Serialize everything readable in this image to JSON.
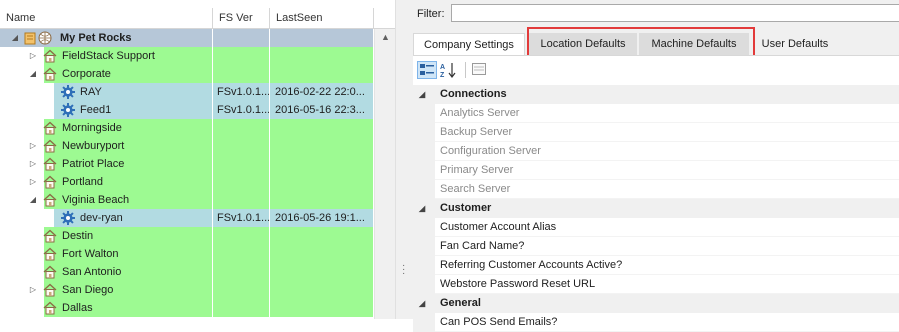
{
  "tree": {
    "columns": [
      "Name",
      "FS Ver",
      "LastSeen"
    ],
    "rows": [
      {
        "name": "My Pet Rocks",
        "fs": "",
        "last": "",
        "level": 0,
        "bg": "root",
        "expander": "expanded",
        "icon": "root-org-icon",
        "bold": true
      },
      {
        "name": "FieldStack Support",
        "fs": "",
        "last": "",
        "level": 1,
        "bg": "green",
        "expander": "collapsed",
        "icon": "house-icon"
      },
      {
        "name": "Corporate",
        "fs": "",
        "last": "",
        "level": 1,
        "bg": "green",
        "expander": "expanded",
        "icon": "house-icon"
      },
      {
        "name": "RAY",
        "fs": "FSv1.0.1...",
        "last": "2016-02-22 22:0...",
        "level": 2,
        "bg": "blue",
        "expander": "none",
        "icon": "gear-icon"
      },
      {
        "name": "Feed1",
        "fs": "FSv1.0.1...",
        "last": "2016-05-16 22:3...",
        "level": 2,
        "bg": "blue",
        "expander": "none",
        "icon": "gear-icon"
      },
      {
        "name": "Morningside",
        "fs": "",
        "last": "",
        "level": 1,
        "bg": "green",
        "expander": "none",
        "icon": "house-icon"
      },
      {
        "name": "Newburyport",
        "fs": "",
        "last": "",
        "level": 1,
        "bg": "green",
        "expander": "collapsed",
        "icon": "house-icon"
      },
      {
        "name": "Patriot Place",
        "fs": "",
        "last": "",
        "level": 1,
        "bg": "green",
        "expander": "collapsed",
        "icon": "house-icon"
      },
      {
        "name": "Portland",
        "fs": "",
        "last": "",
        "level": 1,
        "bg": "green",
        "expander": "collapsed",
        "icon": "house-icon"
      },
      {
        "name": "Viginia Beach",
        "fs": "",
        "last": "",
        "level": 1,
        "bg": "green",
        "expander": "expanded",
        "icon": "house-icon"
      },
      {
        "name": "dev-ryan",
        "fs": "FSv1.0.1...",
        "last": "2016-05-26 19:1...",
        "level": 2,
        "bg": "blue",
        "expander": "none",
        "icon": "gear-icon"
      },
      {
        "name": "Destin",
        "fs": "",
        "last": "",
        "level": 1,
        "bg": "green",
        "expander": "none",
        "icon": "house-icon"
      },
      {
        "name": "Fort Walton",
        "fs": "",
        "last": "",
        "level": 1,
        "bg": "green",
        "expander": "none",
        "icon": "house-icon"
      },
      {
        "name": "San Antonio",
        "fs": "",
        "last": "",
        "level": 1,
        "bg": "green",
        "expander": "none",
        "icon": "house-icon"
      },
      {
        "name": "San Diego",
        "fs": "",
        "last": "",
        "level": 1,
        "bg": "green",
        "expander": "collapsed",
        "icon": "house-icon"
      },
      {
        "name": "Dallas",
        "fs": "",
        "last": "",
        "level": 1,
        "bg": "green",
        "expander": "none",
        "icon": "house-icon"
      }
    ]
  },
  "right": {
    "filter_label": "Filter:",
    "filter_value": "",
    "tabs": [
      {
        "label": "Company Settings",
        "state": "selected"
      },
      {
        "label": "Location Defaults",
        "state": "highlighted"
      },
      {
        "label": "Machine Defaults",
        "state": "highlighted"
      },
      {
        "label": "User Defaults",
        "state": "normal"
      }
    ],
    "toolbar": [
      "categorized-icon",
      "alphabetical-sort-icon",
      "property-pages-icon"
    ],
    "property_grid": [
      {
        "type": "category",
        "label": "Connections"
      },
      {
        "type": "property",
        "label": "Analytics Server",
        "dim": true
      },
      {
        "type": "property",
        "label": "Backup Server",
        "dim": true
      },
      {
        "type": "property",
        "label": "Configuration Server",
        "dim": true
      },
      {
        "type": "property",
        "label": "Primary Server",
        "dim": true
      },
      {
        "type": "property",
        "label": "Search Server",
        "dim": true
      },
      {
        "type": "category",
        "label": "Customer"
      },
      {
        "type": "property",
        "label": "Customer Account Alias",
        "dim": false
      },
      {
        "type": "property",
        "label": "Fan Card Name?",
        "dim": false
      },
      {
        "type": "property",
        "label": "Referring Customer Accounts Active?",
        "dim": false
      },
      {
        "type": "property",
        "label": "Webstore Password Reset URL",
        "dim": false
      },
      {
        "type": "category",
        "label": "General"
      },
      {
        "type": "property",
        "label": "Can POS Send Emails?",
        "dim": false
      }
    ]
  },
  "colors": {
    "location_green": "#9dfa92",
    "machine_blue": "#b2dbe2",
    "root_row": "#b6c7d8",
    "tab_highlight": "#e23a3a"
  }
}
